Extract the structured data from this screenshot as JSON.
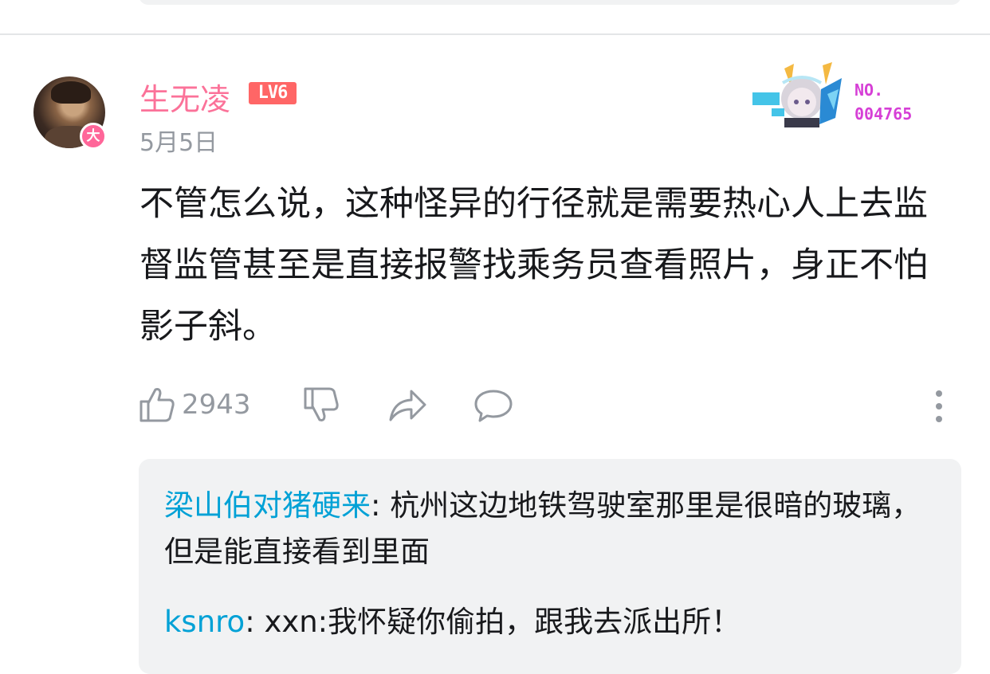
{
  "comment": {
    "username": "生无凌",
    "level": "LV6",
    "avatar_badge": "大",
    "date": "5月5日",
    "text": "不管怎么说，这种怪异的行径就是需要热心人上去监督监管甚至是直接报警找乘务员查看照片，身正不怕影子斜。",
    "decoration": {
      "no_label": "NO.",
      "number": "004765"
    }
  },
  "actions": {
    "like_count": "2943",
    "icons": [
      "thumbs-up-icon",
      "thumbs-down-icon",
      "share-icon",
      "reply-icon",
      "more-icon"
    ]
  },
  "replies": [
    {
      "user": "梁山伯对猪硬来",
      "sep": ": ",
      "text": "杭州这边地铁驾驶室那里是很暗的玻璃，但是能直接看到里面"
    },
    {
      "user": "ksnro",
      "sep": ": ",
      "text": "xxn:我怀疑你偷拍，跟我去派出所！"
    }
  ],
  "colors": {
    "username": "#fb7299",
    "level_badge": "#ff6666",
    "link_blue": "#00a1d6",
    "meta_gray": "#9499a0",
    "reply_bg": "#f1f2f3"
  }
}
